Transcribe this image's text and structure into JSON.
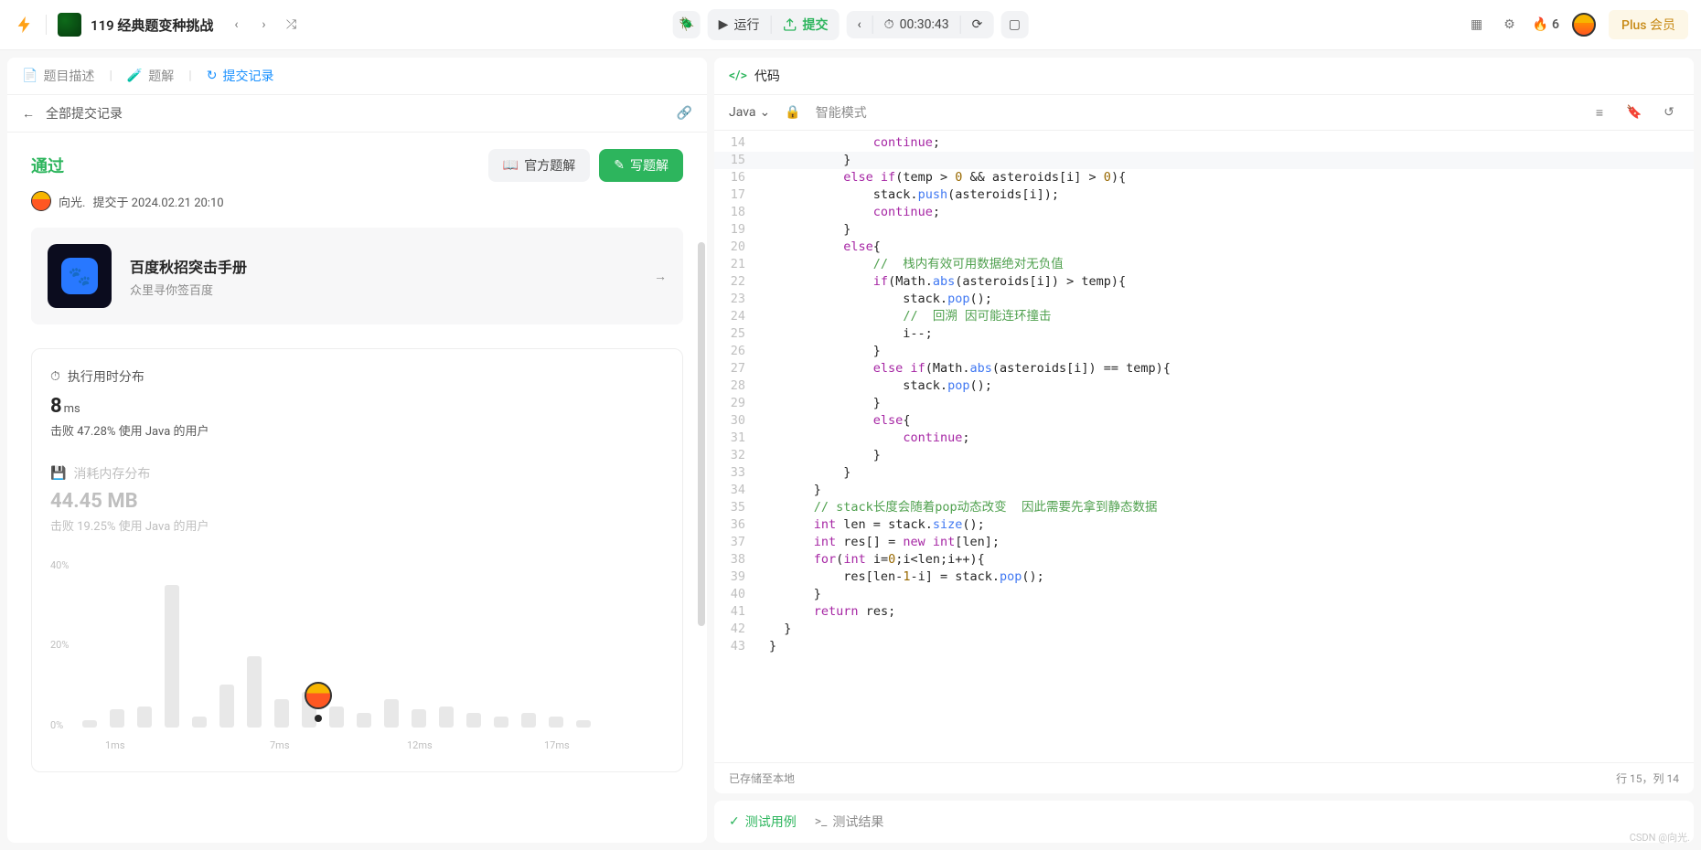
{
  "header": {
    "title": "119 经典题变种挑战",
    "run_label": "运行",
    "submit_label": "提交",
    "timer": "00:30:43",
    "streak": "6",
    "plus_label": "Plus 会员"
  },
  "left": {
    "tabs": {
      "desc": "题目描述",
      "sol": "题解",
      "subm": "提交记录"
    },
    "subnav": "全部提交记录",
    "status": "通过",
    "btn_off": "官方题解",
    "btn_write": "写题解",
    "author": "向光.",
    "submitted_at": "提交于 2024.02.21 20:10",
    "promo": {
      "title": "百度秋招突击手册",
      "sub": "众里寻你签百度"
    },
    "stat": {
      "hdr": "执行用时分布",
      "value": "8",
      "unit": "ms",
      "beat": "击败 47.28% 使用 Java 的用户"
    },
    "mem": {
      "hdr": "消耗内存分布",
      "value": "44.45",
      "unit": "MB",
      "beat": "击败 19.25% 使用 Java 的用户"
    },
    "ylabels": {
      "a": "40%",
      "b": "20%",
      "c": "0%"
    },
    "xlabels": {
      "a": "1ms",
      "b": "7ms",
      "c": "12ms",
      "d": "17ms"
    }
  },
  "editor": {
    "title": "代码",
    "lang": "Java",
    "smart_mode": "智能模式",
    "saved": "已存储至本地",
    "cursor": "行 15，列 14",
    "lines": [
      {
        "n": 14,
        "html": "              <span class='kw'>continue</span>;"
      },
      {
        "n": 15,
        "html": "          }",
        "hl": true
      },
      {
        "n": 16,
        "html": "          <span class='kw'>else if</span>(temp > <span class='num'>0</span> && asteroids[i] > <span class='num'>0</span>){"
      },
      {
        "n": 17,
        "html": "              stack.<span class='fn'>push</span>(asteroids[i]);"
      },
      {
        "n": 18,
        "html": "              <span class='kw'>continue</span>;"
      },
      {
        "n": 19,
        "html": "          }"
      },
      {
        "n": 20,
        "html": "          <span class='kw'>else</span>{"
      },
      {
        "n": 21,
        "html": "              <span class='cm'>//  栈内有效可用数据绝对无负值</span>"
      },
      {
        "n": 22,
        "html": "              <span class='kw'>if</span>(Math.<span class='fn'>abs</span>(asteroids[i]) > temp){"
      },
      {
        "n": 23,
        "html": "                  stack.<span class='fn'>pop</span>();"
      },
      {
        "n": 24,
        "html": "                  <span class='cm'>//  回溯 因可能连环撞击</span>"
      },
      {
        "n": 25,
        "html": "                  i--;"
      },
      {
        "n": 26,
        "html": "              }"
      },
      {
        "n": 27,
        "html": "              <span class='kw'>else if</span>(Math.<span class='fn'>abs</span>(asteroids[i]) == temp){"
      },
      {
        "n": 28,
        "html": "                  stack.<span class='fn'>pop</span>();"
      },
      {
        "n": 29,
        "html": "              }"
      },
      {
        "n": 30,
        "html": "              <span class='kw'>else</span>{"
      },
      {
        "n": 31,
        "html": "                  <span class='kw'>continue</span>;"
      },
      {
        "n": 32,
        "html": "              }"
      },
      {
        "n": 33,
        "html": "          }"
      },
      {
        "n": 34,
        "html": "      }"
      },
      {
        "n": 35,
        "html": "      <span class='cm'>// stack长度会随着pop动态改变  因此需要先拿到静态数据</span>"
      },
      {
        "n": 36,
        "html": "      <span class='kw'>int</span> len = stack.<span class='fn'>size</span>();"
      },
      {
        "n": 37,
        "html": "      <span class='kw'>int</span> res[] = <span class='kw'>new</span> <span class='kw'>int</span>[len];"
      },
      {
        "n": 38,
        "html": "      <span class='kw'>for</span>(<span class='kw'>int</span> i=<span class='num'>0</span>;i&lt;len;i++){"
      },
      {
        "n": 39,
        "html": "          res[len-<span class='num'>1</span>-i] = stack.<span class='fn'>pop</span>();"
      },
      {
        "n": 40,
        "html": "      }"
      },
      {
        "n": 41,
        "html": "      <span class='kw'>return</span> res;"
      },
      {
        "n": 42,
        "html": "  }"
      },
      {
        "n": 43,
        "html": "}"
      }
    ]
  },
  "tests": {
    "cases": "测试用例",
    "results": "测试结果"
  },
  "chart_data": {
    "type": "bar",
    "xlabel_unit": "ms",
    "ylabel_unit": "%",
    "ylim": [
      0,
      45
    ],
    "bars": [
      {
        "x": 1,
        "pct": 2
      },
      {
        "x": 2,
        "pct": 5
      },
      {
        "x": 3,
        "pct": 6
      },
      {
        "x": 4,
        "pct": 40
      },
      {
        "x": 5,
        "pct": 3
      },
      {
        "x": 6,
        "pct": 12
      },
      {
        "x": 7,
        "pct": 20
      },
      {
        "x": 8,
        "pct": 8
      },
      {
        "x": 9,
        "pct": 10
      },
      {
        "x": 10,
        "pct": 6
      },
      {
        "x": 11,
        "pct": 4
      },
      {
        "x": 12,
        "pct": 8
      },
      {
        "x": 13,
        "pct": 5
      },
      {
        "x": 14,
        "pct": 6
      },
      {
        "x": 15,
        "pct": 4
      },
      {
        "x": 16,
        "pct": 3
      },
      {
        "x": 17,
        "pct": 4
      },
      {
        "x": 18,
        "pct": 3
      },
      {
        "x": 19,
        "pct": 2
      }
    ],
    "marker_x": 8
  },
  "watermark": "CSDN @向光."
}
